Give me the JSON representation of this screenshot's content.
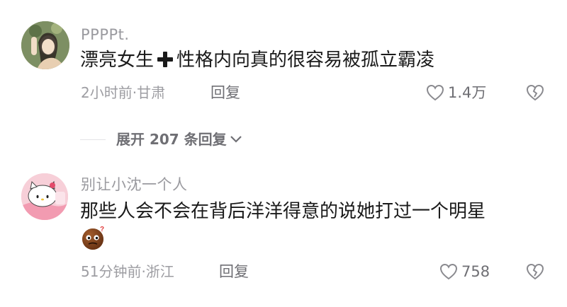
{
  "comments": [
    {
      "username": "PPPPt.",
      "text_before": "漂亮女生",
      "text_after": "性格内向真的很容易被孤立霸凌",
      "inline_emoji": "plus-icon",
      "meta": "2小时前·甘肃",
      "reply_label": "回复",
      "likes": "1.4万"
    },
    {
      "username": "别让小沈一个人",
      "text": "那些人会不会在背后洋洋得意的说她打过一个明星",
      "emoji": "confused-face-emoji",
      "meta": "51分钟前·浙江",
      "reply_label": "回复",
      "likes": "758"
    }
  ],
  "expand_replies": {
    "label": "展开 207 条回复"
  },
  "colors": {
    "username": "#9a9a9f",
    "content": "#1a1a1a",
    "meta": "#9d9da2"
  }
}
